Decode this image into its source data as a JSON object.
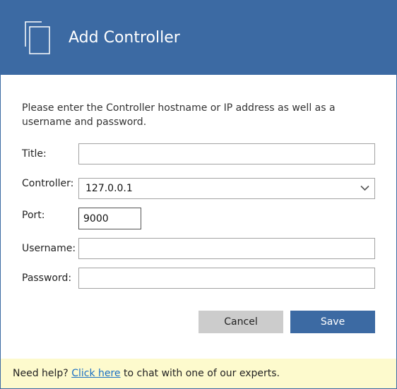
{
  "dialog": {
    "title": "Add Controller",
    "header_icon": "documents-icon",
    "intro": "Please enter the Controller hostname or IP address as well as a username and password.",
    "fields": {
      "title": {
        "label": "Title:",
        "value": ""
      },
      "controller": {
        "label": "Controller:",
        "value": "127.0.0.1",
        "dropdown_icon": "chevron-down-icon"
      },
      "port": {
        "label": "Port:",
        "value": "9000"
      },
      "username": {
        "label": "Username:",
        "value": ""
      },
      "password": {
        "label": "Password:",
        "value": ""
      }
    },
    "buttons": {
      "cancel": "Cancel",
      "save": "Save"
    },
    "footer": {
      "prefix": "Need help?",
      "link": "Click here",
      "suffix": "to chat with one of our experts."
    }
  },
  "colors": {
    "header": "#3c6aa3",
    "save_button": "#3c6aa3",
    "cancel_button": "#cccccc",
    "footer_background": "#fdfacd",
    "link": "#1a6fc4"
  }
}
